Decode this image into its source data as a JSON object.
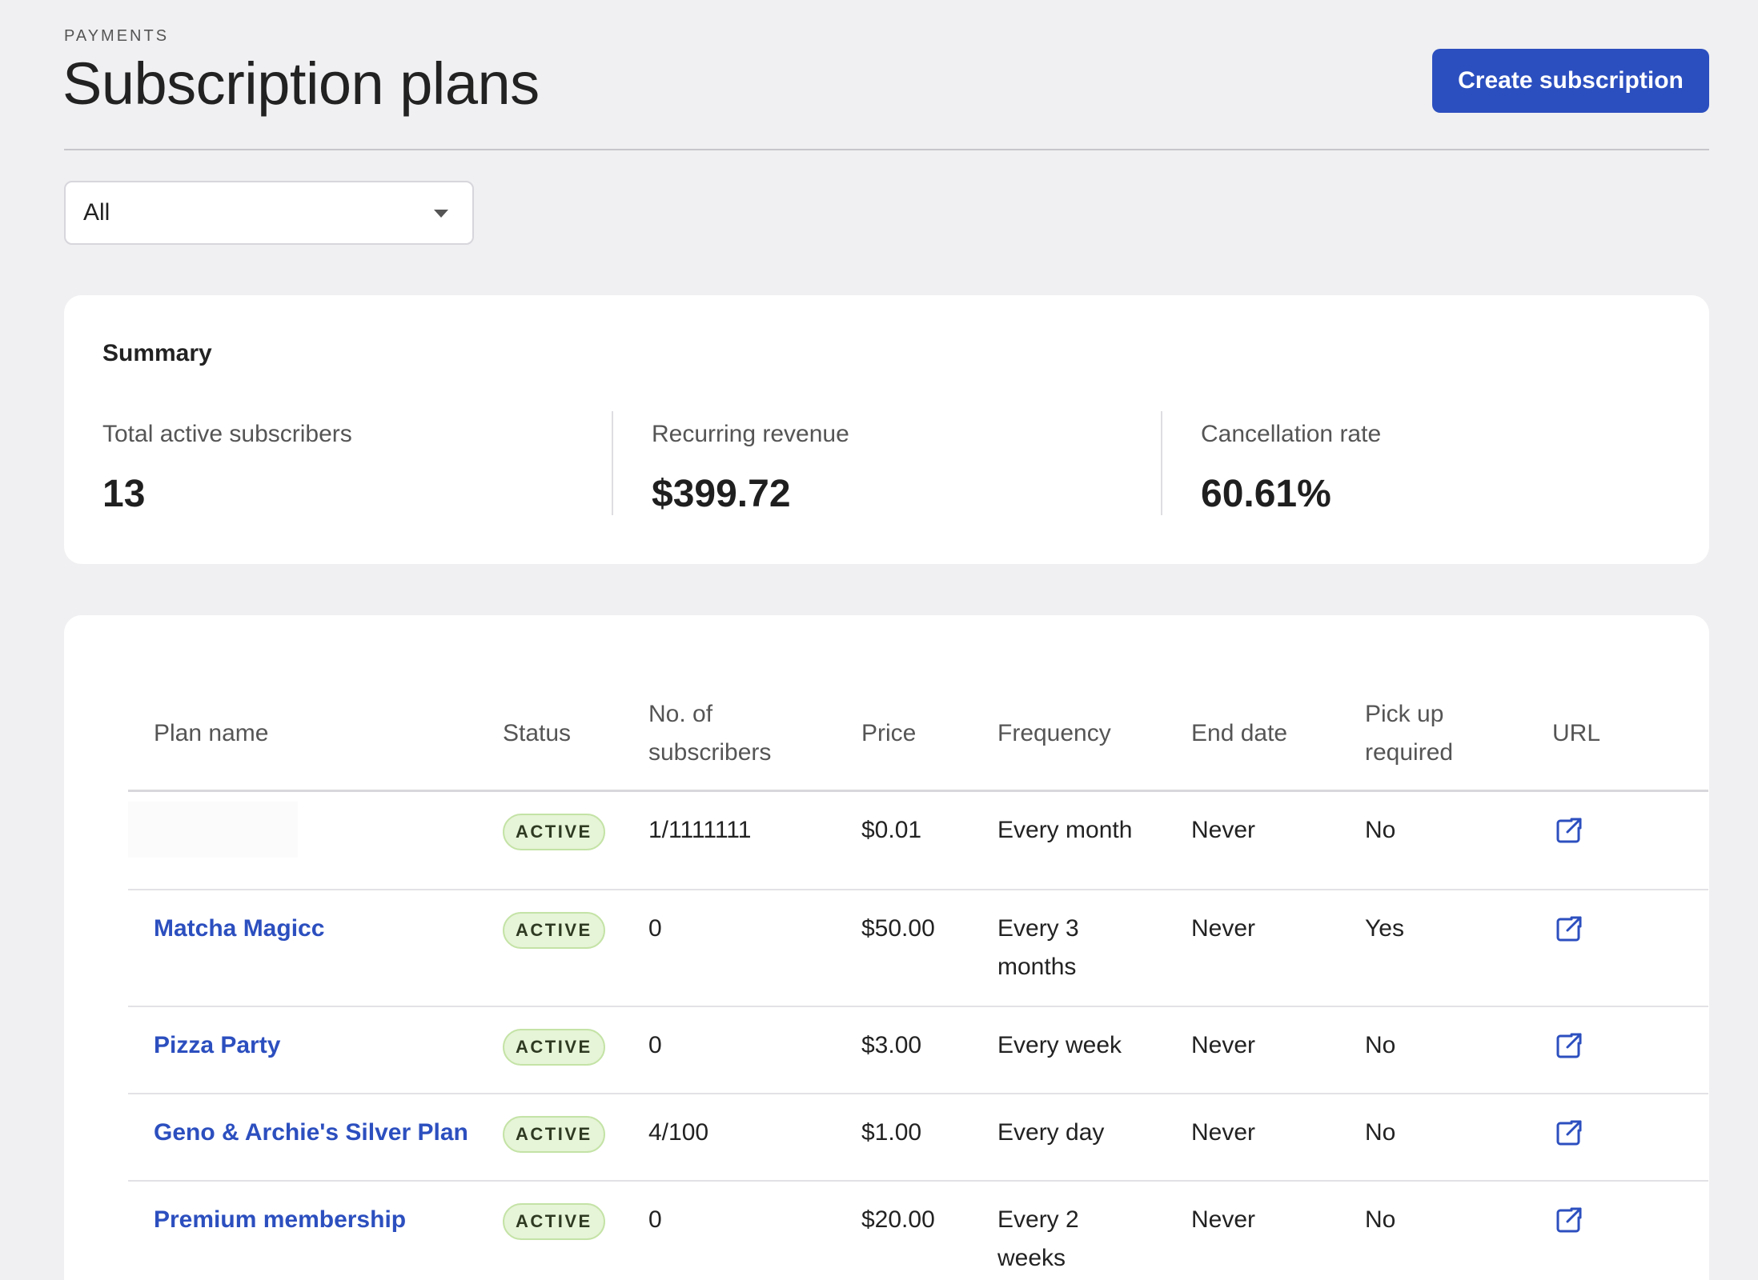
{
  "header": {
    "eyebrow": "PAYMENTS",
    "title": "Subscription plans",
    "create_label": "Create subscription"
  },
  "filter": {
    "selected": "All"
  },
  "summary": {
    "title": "Summary",
    "stats": [
      {
        "label": "Total active subscribers",
        "value": "13"
      },
      {
        "label": "Recurring revenue",
        "value": "$399.72"
      },
      {
        "label": "Cancellation rate",
        "value": "60.61%"
      }
    ]
  },
  "table": {
    "headers": {
      "plan_name": "Plan name",
      "status": "Status",
      "subscribers": "No. of subscribers",
      "price": "Price",
      "frequency": "Frequency",
      "end_date": "End date",
      "pickup": "Pick up required",
      "url": "URL"
    },
    "rows": [
      {
        "name": "",
        "status": "ACTIVE",
        "subscribers": "1/1111111",
        "price": "$0.01",
        "frequency": "Every month",
        "end_date": "Never",
        "pickup": "No"
      },
      {
        "name": "Matcha Magicc",
        "status": "ACTIVE",
        "subscribers": "0",
        "price": "$50.00",
        "frequency": "Every 3 months",
        "end_date": "Never",
        "pickup": "Yes"
      },
      {
        "name": "Pizza Party",
        "status": "ACTIVE",
        "subscribers": "0",
        "price": "$3.00",
        "frequency": "Every week",
        "end_date": "Never",
        "pickup": "No"
      },
      {
        "name": "Geno & Archie's Silver Plan",
        "status": "ACTIVE",
        "subscribers": "4/100",
        "price": "$1.00",
        "frequency": "Every day",
        "end_date": "Never",
        "pickup": "No"
      },
      {
        "name": "Premium membership",
        "status": "ACTIVE",
        "subscribers": "0",
        "price": "$20.00",
        "frequency": "Every 2 weeks",
        "end_date": "Never",
        "pickup": "No"
      }
    ],
    "url_icon": "external-link-icon"
  },
  "colors": {
    "accent": "#2c4fbf",
    "badge_bg": "#e6f4d7",
    "page_bg": "#f0f0f2"
  }
}
